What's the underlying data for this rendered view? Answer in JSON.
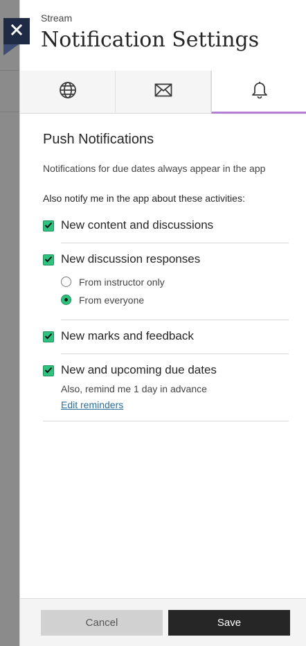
{
  "header": {
    "eyebrow": "Stream",
    "title": "Notification Settings"
  },
  "close": {
    "icon": "close-icon"
  },
  "tabs": [
    {
      "name": "tab-web",
      "icon": "globe-icon",
      "active": false
    },
    {
      "name": "tab-email",
      "icon": "envelope-icon",
      "active": false
    },
    {
      "name": "tab-push",
      "icon": "bell-icon",
      "active": true
    }
  ],
  "section": {
    "title": "Push Notifications",
    "note": "Notifications for due dates always appear in the app",
    "subtitle": "Also notify me in the app about these activities:"
  },
  "options": {
    "content": "New content and discussions",
    "responses": "New discussion responses",
    "marks": "New marks and feedback",
    "due": "New and upcoming due dates"
  },
  "radios": {
    "instructor": "From instructor only",
    "everyone": "From everyone",
    "selected": "everyone"
  },
  "reminder": {
    "text": "Also, remind me 1 day in advance",
    "link": "Edit reminders"
  },
  "footer": {
    "cancel": "Cancel",
    "save": "Save"
  },
  "colors": {
    "accent": "#b57ed3",
    "check": "#2ec27e",
    "close_bg": "#1f2a44",
    "link": "#2a6f9c"
  }
}
